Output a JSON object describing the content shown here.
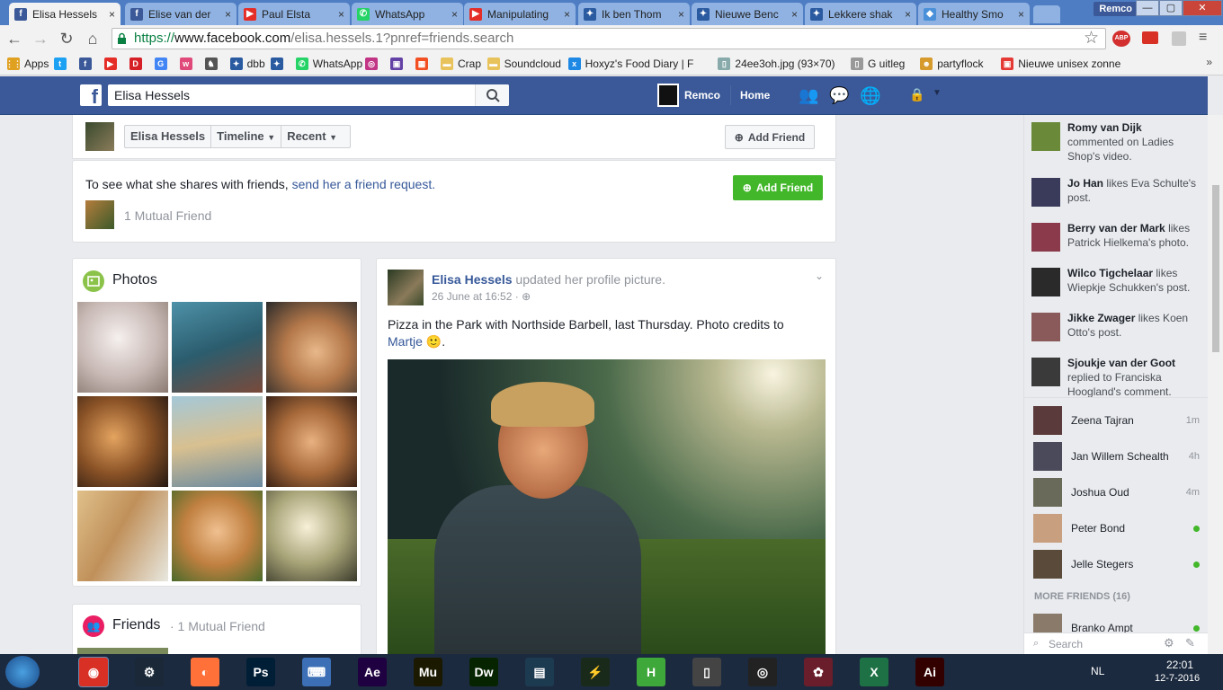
{
  "tabs": [
    {
      "label": "Elisa Hessels",
      "color": "#3b5998",
      "glyph": "f",
      "active": true
    },
    {
      "label": "Elise van der",
      "color": "#3b5998",
      "glyph": "f"
    },
    {
      "label": "Paul Elsta",
      "color": "#e52d27",
      "glyph": "▶"
    },
    {
      "label": "WhatsApp",
      "color": "#25d366",
      "glyph": "✆"
    },
    {
      "label": "Manipulating",
      "color": "#e52d27",
      "glyph": "▶"
    },
    {
      "label": "Ik ben Thom",
      "color": "#2a5aa0",
      "glyph": "✦"
    },
    {
      "label": "Nieuwe Benc",
      "color": "#2a5aa0",
      "glyph": "✦"
    },
    {
      "label": "Lekkere shak",
      "color": "#2a5aa0",
      "glyph": "✦"
    },
    {
      "label": "Healthy Smo",
      "color": "#4a90d9",
      "glyph": "◆"
    }
  ],
  "window": {
    "profile": "Remco",
    "minimize": "—",
    "maximize": "▢",
    "close": "✕"
  },
  "address": {
    "scheme": "https://",
    "host": "www.facebook.com",
    "path": "/elisa.hessels.1?pnref=friends.search"
  },
  "bookmarks": [
    {
      "label": "Apps",
      "color": "#e0a020",
      "glyph": "⋮⋮"
    },
    {
      "label": "",
      "color": "#1da1f2",
      "glyph": "t"
    },
    {
      "label": "",
      "color": "#3b5998",
      "glyph": "f"
    },
    {
      "label": "",
      "color": "#e52d27",
      "glyph": "▶"
    },
    {
      "label": "",
      "color": "#d61f26",
      "glyph": "D"
    },
    {
      "label": "",
      "color": "#4285f4",
      "glyph": "G"
    },
    {
      "label": "",
      "color": "#e04a7a",
      "glyph": "w"
    },
    {
      "label": "",
      "color": "#555",
      "glyph": "♞"
    },
    {
      "label": "dbb",
      "color": "#2a5aa0",
      "glyph": "✦"
    },
    {
      "label": "",
      "color": "#2a5aa0",
      "glyph": "✦"
    },
    {
      "label": "WhatsApp",
      "color": "#25d366",
      "glyph": "✆"
    },
    {
      "label": "",
      "color": "#c13584",
      "glyph": "◎"
    },
    {
      "label": "",
      "color": "#6441a5",
      "glyph": "▣"
    },
    {
      "label": "",
      "color": "#f25022",
      "glyph": "▦"
    },
    {
      "label": "Crap",
      "color": "#e8c25a",
      "glyph": "▬"
    },
    {
      "label": "Soundcloud",
      "color": "#e8c25a",
      "glyph": "▬"
    },
    {
      "label": "Hoxyz's Food Diary | F",
      "color": "#1e88e5",
      "glyph": "x"
    },
    {
      "label": "24ee3oh.jpg (93×70)",
      "color": "#8aa",
      "glyph": "▯"
    },
    {
      "label": "G uitleg",
      "color": "#999",
      "glyph": "▯"
    },
    {
      "label": "partyflock",
      "color": "#d69a2d",
      "glyph": "☻"
    },
    {
      "label": "Nieuwe unisex zonne",
      "color": "#e53935",
      "glyph": "▣"
    }
  ],
  "fb": {
    "search_value": "Elisa Hessels",
    "user": "Remco",
    "home": "Home"
  },
  "profile_nav": {
    "name": "Elisa Hessels",
    "timeline": "Timeline",
    "recent": "Recent",
    "add_friend": "Add Friend"
  },
  "notice": {
    "text": "To see what she shares with friends,",
    "link": "send her a friend request.",
    "mutual": "1 Mutual Friend",
    "add_friend": "Add Friend"
  },
  "photos": {
    "title": "Photos"
  },
  "friends": {
    "title": "Friends",
    "sub": "· 1 Mutual Friend"
  },
  "post": {
    "author": "Elisa Hessels",
    "action": "updated her profile picture.",
    "time": "26 June at 16:52",
    "text": "Pizza in the Park with Northside Barbell, last Thursday. Photo credits to",
    "link": "Martje",
    "emoji": "🙂",
    "end": "."
  },
  "ticker": [
    {
      "name": "Romy van Dijk",
      "rest": "commented on Ladies Shop's video."
    },
    {
      "name": "Jo Han",
      "rest": "likes Eva Schulte's post."
    },
    {
      "name": "Berry van der Mark",
      "rest": "likes Patrick Hielkema's photo."
    },
    {
      "name": "Wilco Tigchelaar",
      "rest": "likes Wiepkje Schukken's post."
    },
    {
      "name": "Jikke Zwager",
      "rest": "likes Koen Otto's post."
    },
    {
      "name": "Sjoukje van der Goot",
      "rest": "replied to Franciska Hoogland's comment."
    }
  ],
  "chat": [
    {
      "name": "Zeena Tajran",
      "time": "1m"
    },
    {
      "name": "Jan Willem Schealth",
      "time": "4h"
    },
    {
      "name": "Joshua Oud",
      "time": "4m"
    },
    {
      "name": "Peter Bond",
      "time": ""
    },
    {
      "name": "Jelle Stegers",
      "time": ""
    }
  ],
  "more_friends": "MORE FRIENDS (16)",
  "chat_next": "Branko Ampt",
  "chat_search": "Search",
  "taskbar": {
    "lang": "NL",
    "time": "22:01",
    "date": "12-7-2016"
  },
  "taskbar_apps": [
    {
      "glyph": "◉",
      "color": "#d93025"
    },
    {
      "glyph": "⚙",
      "color": "#1b2838"
    },
    {
      "glyph": "◐",
      "color": "#ff7139"
    },
    {
      "glyph": "Ps",
      "color": "#001e36"
    },
    {
      "glyph": "⌨",
      "color": "#3c6fb6"
    },
    {
      "glyph": "Ae",
      "color": "#1f0040"
    },
    {
      "glyph": "Mu",
      "color": "#1b1a00"
    },
    {
      "glyph": "Dw",
      "color": "#072401"
    },
    {
      "glyph": "▤",
      "color": "#1d3b50"
    },
    {
      "glyph": "⚡",
      "color": "#1a2a1a"
    },
    {
      "glyph": "H",
      "color": "#3fa83a"
    },
    {
      "glyph": "▯",
      "color": "#444"
    },
    {
      "glyph": "◎",
      "color": "#222"
    },
    {
      "glyph": "✿",
      "color": "#6a1d2a"
    },
    {
      "glyph": "X",
      "color": "#1e7145"
    },
    {
      "glyph": "Ai",
      "color": "#330000"
    }
  ]
}
